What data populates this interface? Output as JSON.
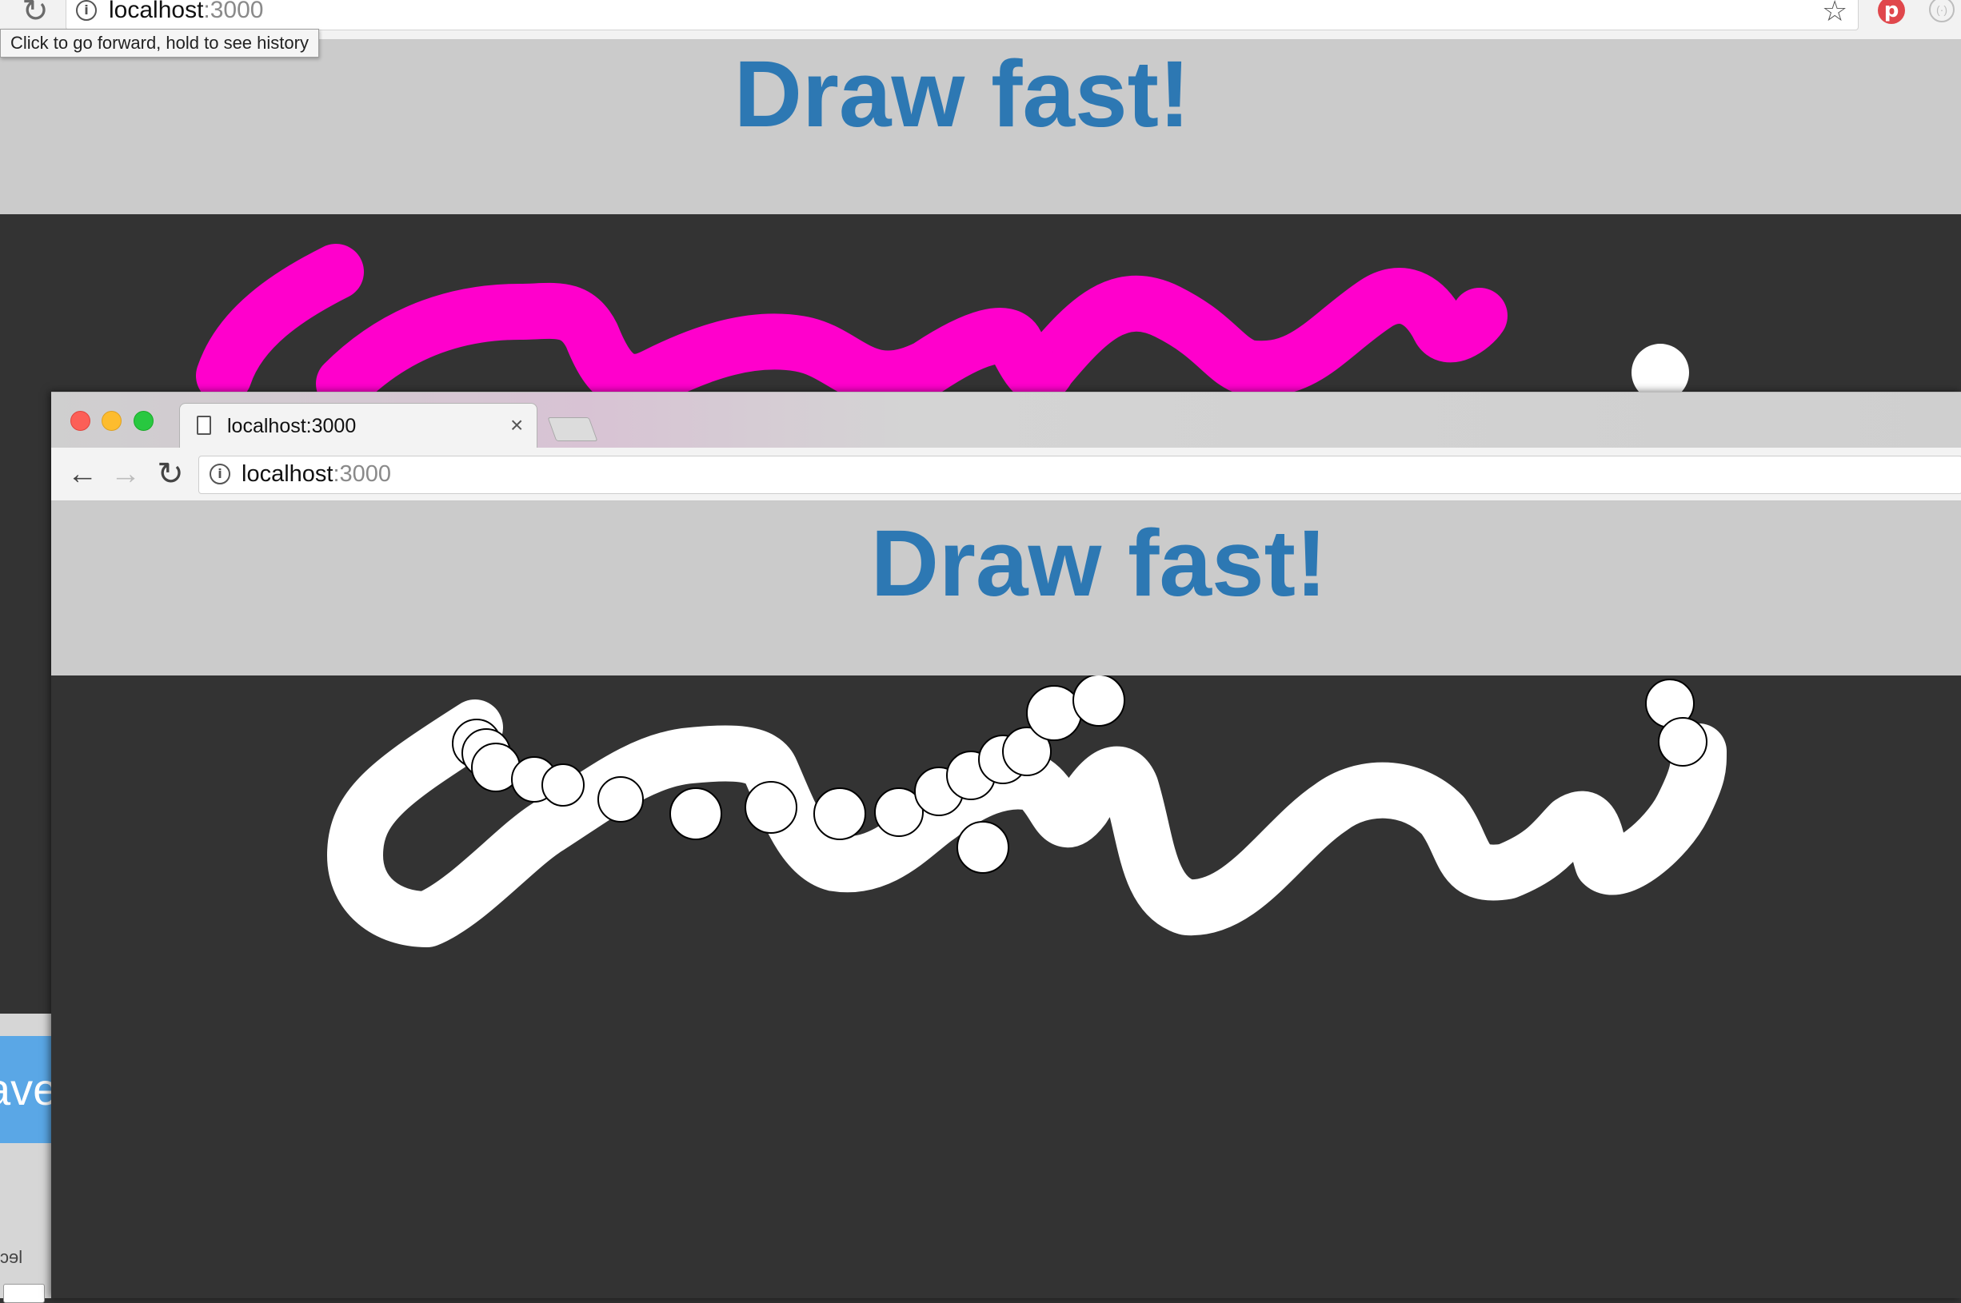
{
  "colors": {
    "title": "#2d78b3",
    "header_bg": "#cbcbcb",
    "canvas_bg": "#333333",
    "stroke_magenta": "#ff00cc",
    "stroke_white": "#ffffff",
    "save_button": "#5aa7e6"
  },
  "back_window": {
    "address": {
      "host": "localhost",
      "port": ":3000"
    },
    "tooltip": "Click to go forward, hold to see history",
    "title": "Draw fast!",
    "icons": [
      "reload-icon",
      "info-icon",
      "star-icon",
      "pinterest-icon",
      "extension-icon"
    ]
  },
  "left_window": {
    "save_label": "ave"
  },
  "front_window": {
    "tab_title": "localhost:3000",
    "tab_close": "×",
    "address": {
      "host": "localhost",
      "port": ":3000"
    },
    "title": "Draw fast!",
    "icons": [
      "back-arrow-icon",
      "forward-arrow-icon",
      "reload-icon",
      "info-icon",
      "document-icon",
      "close-icon"
    ]
  }
}
